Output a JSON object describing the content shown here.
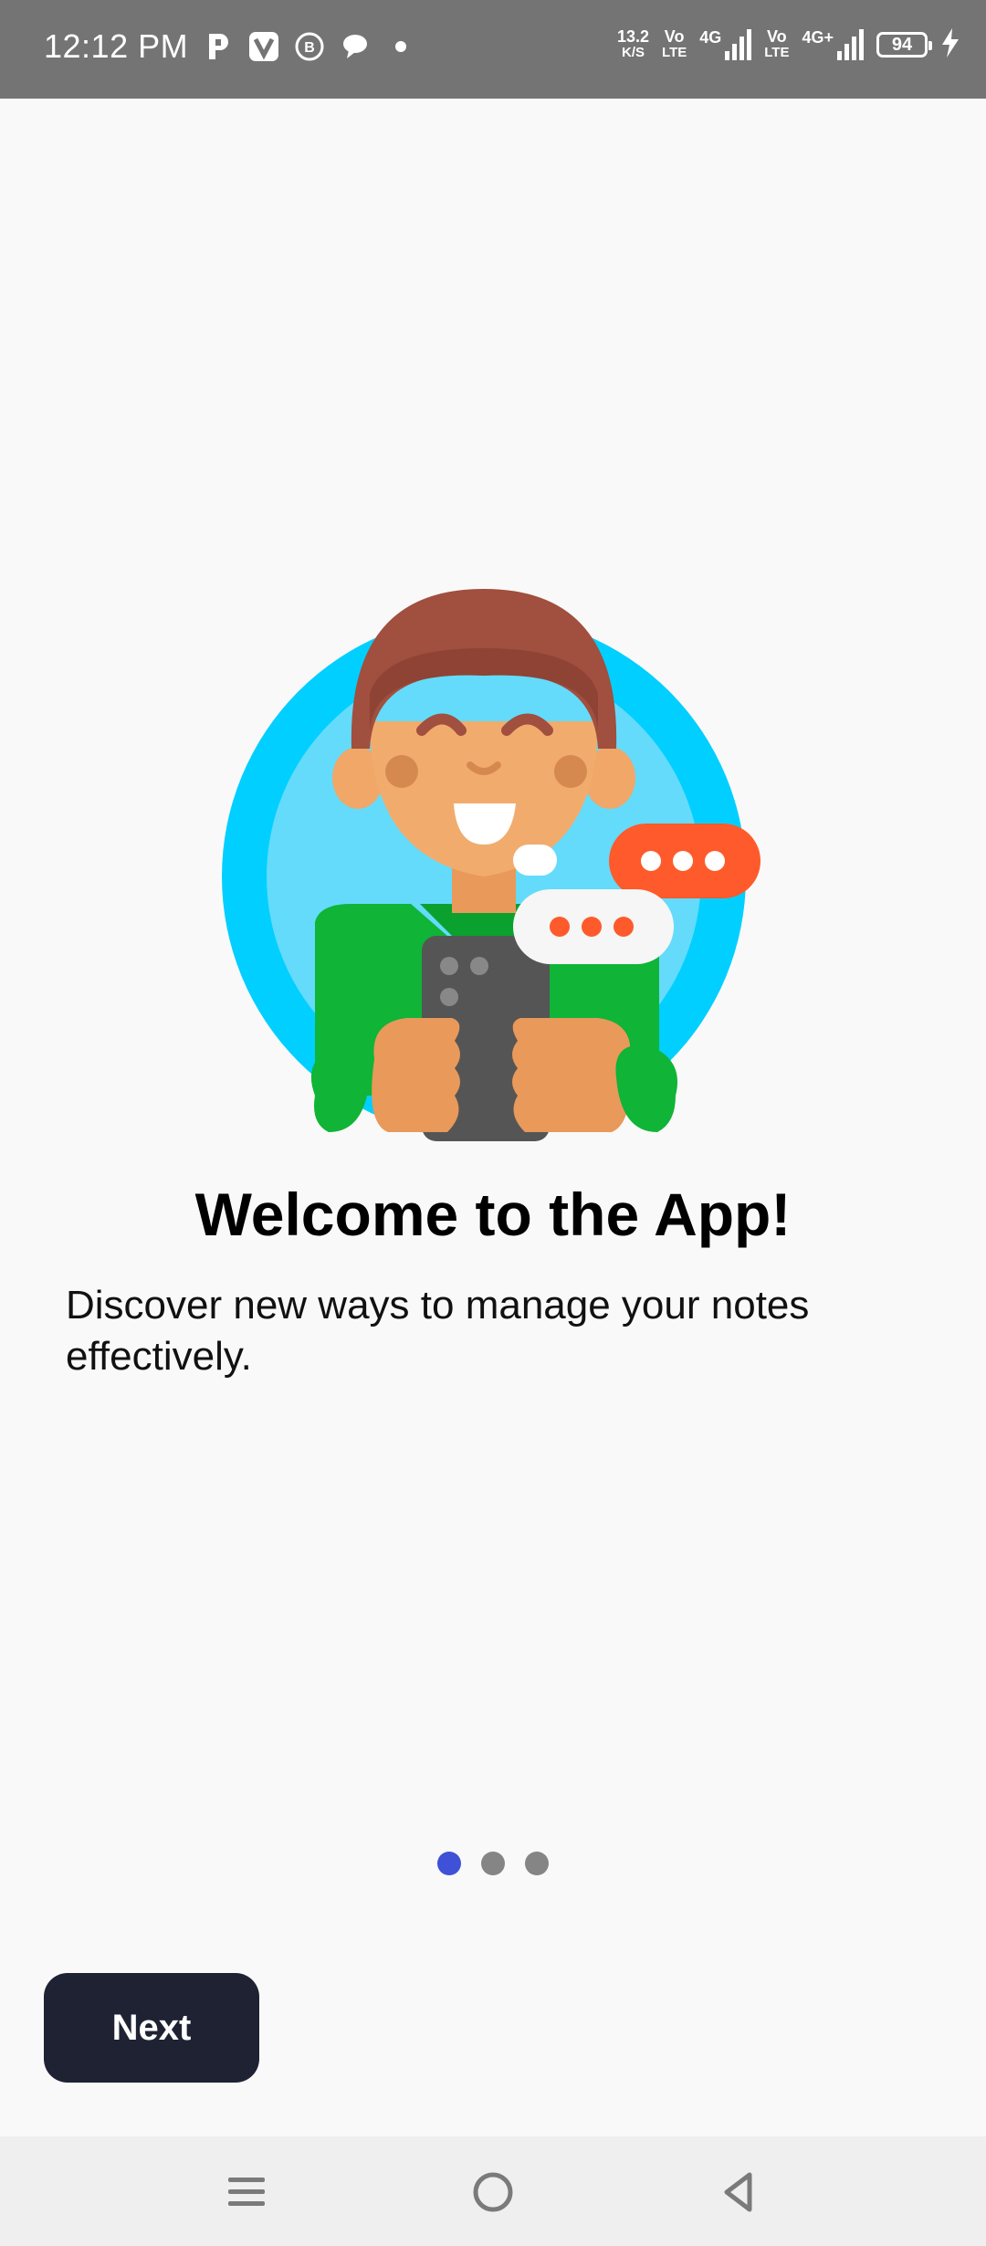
{
  "status_bar": {
    "time": "12:12 PM",
    "notification_icons": [
      "p-app-icon",
      "v-app-icon",
      "b-app-icon",
      "chat-bubble-icon",
      "dot-icon"
    ],
    "net_speed_value": "13.2",
    "net_speed_unit": "K/S",
    "volte1_top": "Vo",
    "volte1_bottom": "LTE",
    "network1": "4G",
    "volte2_top": "Vo",
    "volte2_bottom": "LTE",
    "network2": "4G+",
    "battery_level": "94"
  },
  "onboarding": {
    "title": "Welcome to the App!",
    "subtitle": "Discover new ways to manage your notes effectively.",
    "page_count": 3,
    "active_page": 0,
    "next_label": "Next"
  },
  "colors": {
    "accent_dot": "#3f51d6",
    "inactive_dot": "#858585",
    "button_bg": "#1e2233",
    "circle_outer": "#00cfff",
    "circle_inner": "#64dbfb",
    "jacket": "#10b436",
    "bubble_orange": "#ff5a2b"
  },
  "nav_bar": {
    "buttons": [
      "recents-menu-icon",
      "home-circle-icon",
      "back-triangle-icon"
    ]
  }
}
